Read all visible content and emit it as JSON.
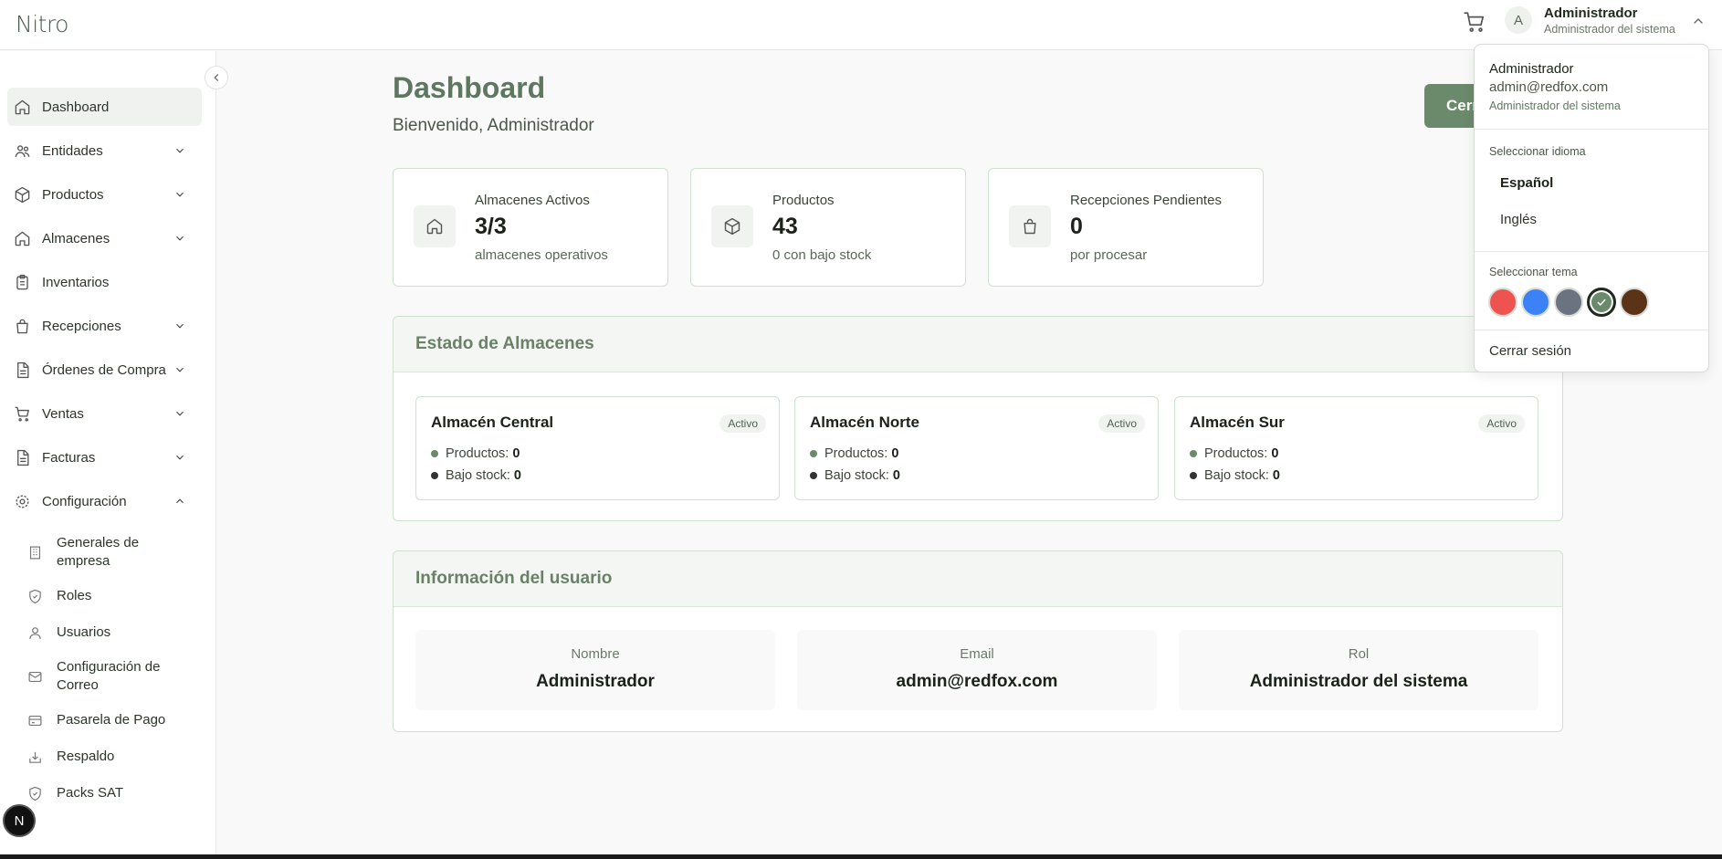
{
  "app": {
    "logo": "Nitro"
  },
  "header": {
    "avatar_initial": "A",
    "user_name": "Administrador",
    "user_role": "Administrador del sistema"
  },
  "sidebar": {
    "items": [
      {
        "label": "Dashboard",
        "icon": "home-icon",
        "active": true,
        "expandable": false
      },
      {
        "label": "Entidades",
        "icon": "users-icon",
        "expandable": true
      },
      {
        "label": "Productos",
        "icon": "box-icon",
        "expandable": true
      },
      {
        "label": "Almacenes",
        "icon": "warehouse-icon",
        "expandable": true
      },
      {
        "label": "Inventarios",
        "icon": "clipboard-icon",
        "expandable": false
      },
      {
        "label": "Recepciones",
        "icon": "bag-icon",
        "expandable": true
      },
      {
        "label": "Órdenes de Compra",
        "icon": "document-icon",
        "expandable": true
      },
      {
        "label": "Ventas",
        "icon": "cart-icon",
        "expandable": true
      },
      {
        "label": "Facturas",
        "icon": "invoice-icon",
        "expandable": true
      },
      {
        "label": "Configuración",
        "icon": "gear-icon",
        "expandable": true,
        "expanded": true
      }
    ],
    "sub_items": [
      {
        "label": "Generales de empresa",
        "icon": "building-icon"
      },
      {
        "label": "Roles",
        "icon": "shield-icon"
      },
      {
        "label": "Usuarios",
        "icon": "user-icon"
      },
      {
        "label": "Configuración de Correo",
        "icon": "mail-icon"
      },
      {
        "label": "Pasarela de Pago",
        "icon": "credit-card-icon"
      },
      {
        "label": "Respaldo",
        "icon": "backup-icon"
      },
      {
        "label": "Packs SAT",
        "icon": "shield-check-icon"
      }
    ],
    "badge": "N"
  },
  "main": {
    "title": "Dashboard",
    "subtitle": "Bienvenido, Administrador",
    "cta_label": "Cerr",
    "stats": [
      {
        "title": "Almacenes Activos",
        "value": "3/3",
        "note": "almacenes operativos",
        "icon": "home-icon"
      },
      {
        "title": "Productos",
        "value": "43",
        "note": "0 con bajo stock",
        "icon": "box-icon"
      },
      {
        "title": "Recepciones Pendientes",
        "value": "0",
        "note": "por procesar",
        "icon": "bag-icon"
      }
    ],
    "warehouses_title": "Estado de Almacenes",
    "warehouses": [
      {
        "name": "Almacén Central",
        "status": "Activo",
        "products_label": "Productos:",
        "products": "0",
        "low_label": "Bajo stock:",
        "low": "0"
      },
      {
        "name": "Almacén Norte",
        "status": "Activo",
        "products_label": "Productos:",
        "products": "0",
        "low_label": "Bajo stock:",
        "low": "0"
      },
      {
        "name": "Almacén Sur",
        "status": "Activo",
        "products_label": "Productos:",
        "products": "0",
        "low_label": "Bajo stock:",
        "low": "0"
      }
    ],
    "user_info_title": "Información del usuario",
    "user_info": [
      {
        "label": "Nombre",
        "value": "Administrador"
      },
      {
        "label": "Email",
        "value": "admin@redfox.com"
      },
      {
        "label": "Rol",
        "value": "Administrador del sistema"
      }
    ]
  },
  "dropdown": {
    "name": "Administrador",
    "email": "admin@redfox.com",
    "role": "Administrador del sistema",
    "language_label": "Seleccionar idioma",
    "languages": [
      "Español",
      "Inglés"
    ],
    "selected_language": "Español",
    "theme_label": "Seleccionar tema",
    "themes": [
      {
        "name": "red",
        "color": "#ef5350"
      },
      {
        "name": "blue",
        "color": "#3b82f6"
      },
      {
        "name": "slate",
        "color": "#6b7280"
      },
      {
        "name": "sage",
        "color": "#6b8a6b",
        "selected": true
      },
      {
        "name": "brown",
        "color": "#5b3418"
      }
    ],
    "logout": "Cerrar sesión"
  },
  "colors": {
    "accent": "#6b8a6b",
    "accent_dark": "#5e7760",
    "border": "#cfe2cf"
  }
}
